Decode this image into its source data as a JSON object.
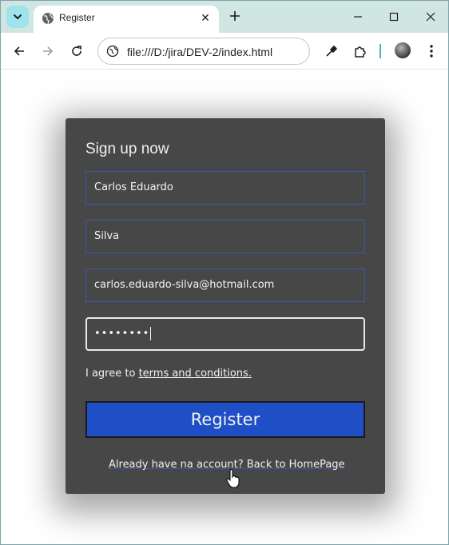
{
  "browser": {
    "tab_title": "Register",
    "url": "file:///D:/jira/DEV-2/index.html"
  },
  "form": {
    "heading": "Sign up now",
    "first_name": "Carlos Eduardo",
    "last_name": "Silva",
    "email": "carlos.eduardo-silva@hotmail.com",
    "password_masked": "••••••••",
    "agree_prefix": "I agree to ",
    "terms_link": "terms and conditions.",
    "register_label": "Register",
    "back_link": "Already have na account? Back to HomePage"
  },
  "colors": {
    "card_bg": "#474747",
    "button_bg": "#1f4fc6",
    "field_border": "#3f56b4",
    "tabstrip_bg": "#cfe6e2"
  },
  "icons": [
    "tab-search-icon",
    "globe-icon",
    "close-icon",
    "plus-icon",
    "minimize-icon",
    "maximize-icon",
    "window-close-icon",
    "back-arrow-icon",
    "forward-arrow-icon",
    "reload-icon",
    "site-info-icon",
    "eyedropper-icon",
    "extensions-icon",
    "profile-avatar",
    "more-menu-icon",
    "hand-cursor-icon"
  ]
}
